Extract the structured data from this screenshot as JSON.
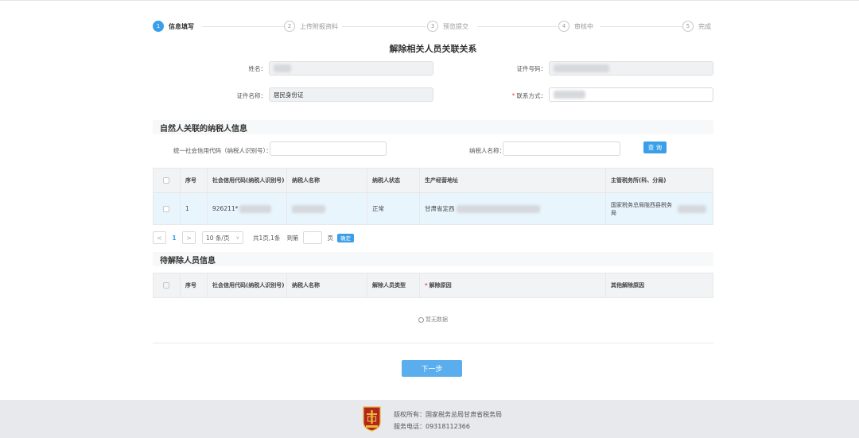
{
  "steps": [
    {
      "num": "1",
      "label": "信息填写"
    },
    {
      "num": "2",
      "label": "上传附报资料"
    },
    {
      "num": "3",
      "label": "预览提交"
    },
    {
      "num": "4",
      "label": "审核中"
    },
    {
      "num": "5",
      "label": "完成"
    }
  ],
  "page_title": "解除相关人员关联关系",
  "form": {
    "name_label": "姓名：",
    "id_number_label": "证件号码：",
    "id_type_label": "证件名称：",
    "id_type_value": "居民身份证",
    "contact_label": "联系方式：",
    "required_mark": "*"
  },
  "section1": {
    "title": "自然人关联的纳税人信息",
    "credit_code_label": "统一社会信用代码（纳税人识别号）：",
    "taxpayer_name_label": "纳税人名称：",
    "query_button": "查 询"
  },
  "table1": {
    "headers": [
      "序号",
      "社会信用代码(纳税人识别号)",
      "纳税人名称",
      "纳税人状态",
      "生产经营地址",
      "主管税务所(科、分局)"
    ],
    "rows": [
      {
        "index": "1",
        "code": "926211*",
        "status": "正常",
        "address": "甘肃省定西",
        "tax_office": "国家税务总局陇西县税务局"
      }
    ]
  },
  "pagination": {
    "prev": "<",
    "current": "1",
    "next": ">",
    "page_size": "10 条/页",
    "summary": "共1页,1条",
    "goto_label": "到第",
    "page_unit": "页",
    "confirm": "确定"
  },
  "section2": {
    "title": "待解除人员信息"
  },
  "table2": {
    "headers": [
      "序号",
      "社会信用代码(纳税人识别号)",
      "纳税人名称",
      "解除人员类型",
      "解除原因",
      "其他解除原因"
    ],
    "empty_text": "暂无数据"
  },
  "next_button": "下一步",
  "footer": {
    "copyright": "版权所有：国家税务总局甘肃省税务局",
    "phone": "服务电话：09318112366"
  },
  "colors": {
    "primary": "#3a9fe8",
    "row_highlight": "#e9f5fd",
    "footer_bg": "#e8e9ec",
    "logo_red": "#b3261e",
    "logo_gold": "#e8b83a"
  }
}
